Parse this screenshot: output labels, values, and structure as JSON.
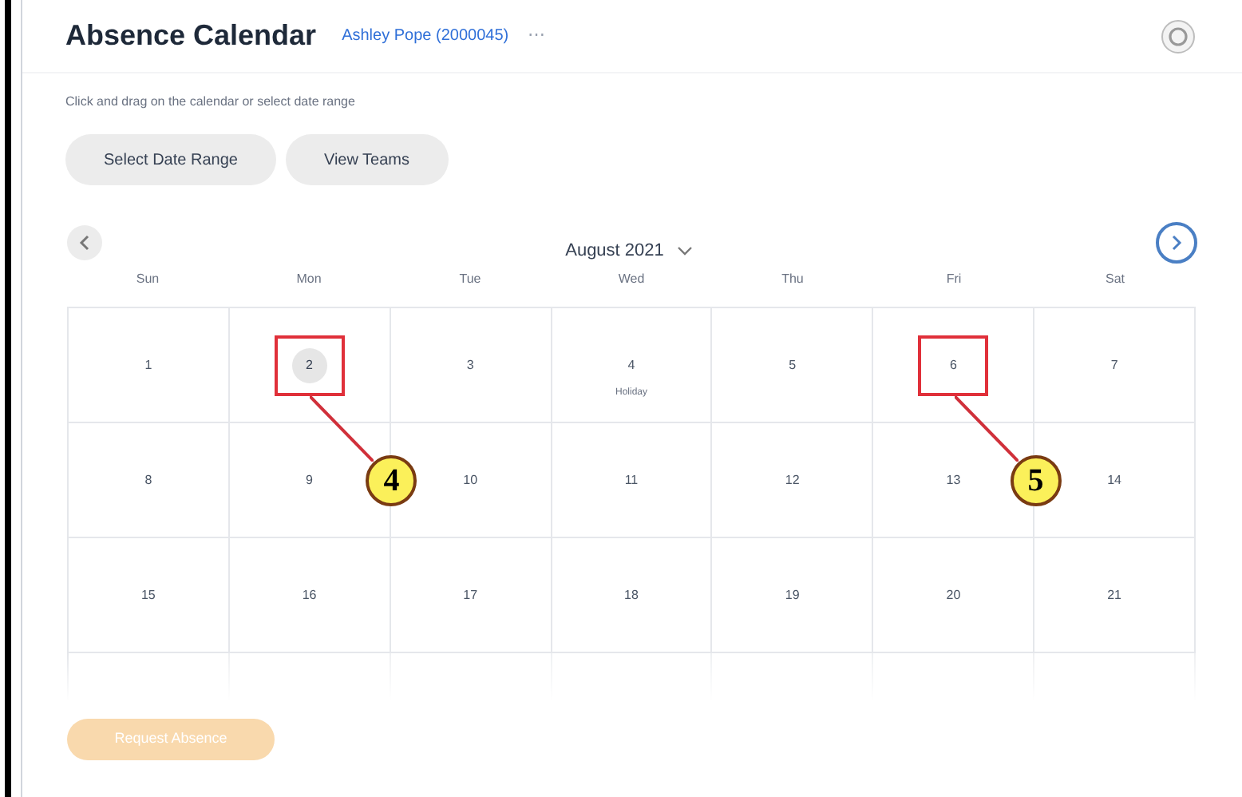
{
  "header": {
    "title": "Absence Calendar",
    "worker_link": "Ashley Pope (2000045)",
    "more_button": "⋯"
  },
  "instructions": "Click and drag on the calendar or select date range",
  "buttons": [
    "Select Date Range",
    "View Teams"
  ],
  "calendar": {
    "month": "August 2021",
    "weekdays": [
      "Sun",
      "Mon",
      "Tue",
      "Wed",
      "Thu",
      "Fri",
      "Sat"
    ],
    "weeks": [
      [
        {
          "day": "1",
          "today": false
        },
        {
          "day": "2",
          "today": true,
          "callout": "4"
        },
        {
          "day": "3",
          "today": false
        },
        {
          "day": "4",
          "today": false,
          "note": "Holiday"
        },
        {
          "day": "5",
          "today": false
        },
        {
          "day": "6",
          "today": false,
          "callout": "5"
        },
        {
          "day": "7",
          "today": false
        }
      ],
      [
        {
          "day": "8",
          "today": false
        },
        {
          "day": "9",
          "today": false
        },
        {
          "day": "10",
          "today": false
        },
        {
          "day": "11",
          "today": false
        },
        {
          "day": "12",
          "today": false
        },
        {
          "day": "13",
          "today": false
        },
        {
          "day": "14",
          "today": false
        }
      ],
      [
        {
          "day": "15",
          "today": false
        },
        {
          "day": "16",
          "today": false
        },
        {
          "day": "17",
          "today": false
        },
        {
          "day": "18",
          "today": false
        },
        {
          "day": "19",
          "today": false
        },
        {
          "day": "20",
          "today": false
        },
        {
          "day": "21",
          "today": false
        }
      ]
    ],
    "partial_week_visible": true
  },
  "request_button": {
    "label": "Request Absence",
    "disabled": true
  }
}
